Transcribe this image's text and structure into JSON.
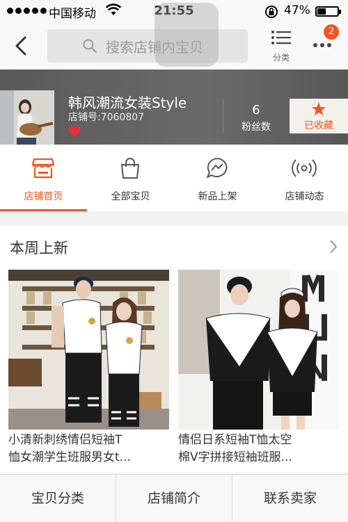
{
  "status_bar": {
    "carrier": "中国移动",
    "time": "21:55",
    "battery": "47%",
    "battery_level": 0.47,
    "signal_bars": 5
  },
  "nav": {
    "back_icon": "chevron-left-icon",
    "search_placeholder": "搜索店铺内宝贝",
    "category_label": "分类",
    "more_badge": "2"
  },
  "shop": {
    "name": "韩风潮流女装Style",
    "shop_number": "店铺号:7060807",
    "fans_count": "6",
    "fans_label": "粉丝数",
    "favorited_label": "已收藏"
  },
  "tabs": [
    {
      "label": "店铺首页",
      "icon": "storefront-icon",
      "active": true
    },
    {
      "label": "全部宝贝",
      "icon": "shopping-bag-icon",
      "active": false
    },
    {
      "label": "新品上架",
      "icon": "chat-lightning-icon",
      "active": false
    },
    {
      "label": "店铺动态",
      "icon": "broadcast-icon",
      "active": false
    }
  ],
  "new_this_week": {
    "title": "本周上新",
    "products": [
      {
        "title_line1": "小清新刺绣情侣短袖T",
        "title_line2": "恤女潮学生班服男女t..."
      },
      {
        "title_line1": "情侣日系短袖T恤太空",
        "title_line2": "棉V字拼接短袖班服..."
      }
    ]
  },
  "bottom_bar": {
    "categories": "宝贝分类",
    "shop_intro": "店铺简介",
    "contact_seller": "联系卖家"
  },
  "colors": {
    "accent": "#f5531c",
    "banner_bg": "#5f5f5f",
    "heart": "#e8303a"
  }
}
